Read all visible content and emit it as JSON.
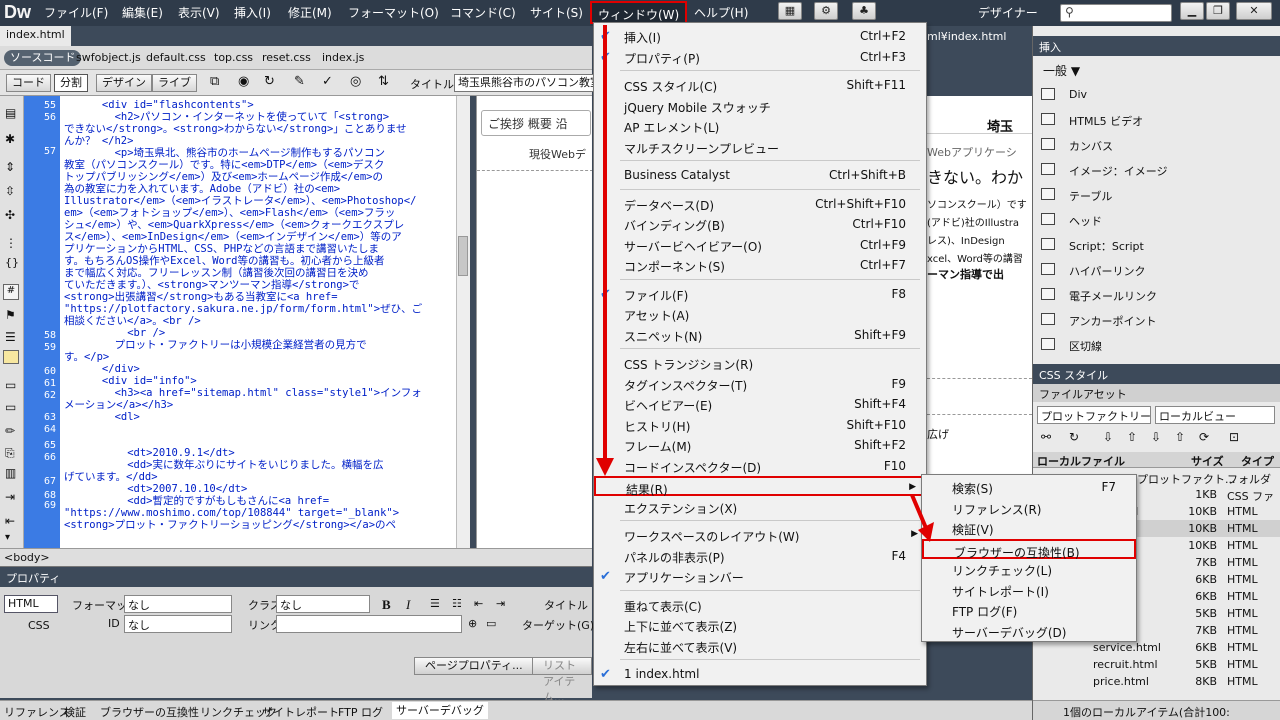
{
  "app": {
    "logo": "Dw",
    "workspace": "デザイナー"
  },
  "menubar": [
    "ファイル(F)",
    "編集(E)",
    "表示(V)",
    "挿入(I)",
    "修正(M)",
    "フォーマット(O)",
    "コマンド(C)",
    "サイト(S)",
    "ウィンドウ(W)",
    "ヘルプ(H)"
  ],
  "document": {
    "tab": "index.html",
    "path": "ml¥index.html",
    "related_files": [
      "ソースコード",
      "swfobject.js",
      "default.css",
      "top.css",
      "reset.css",
      "index.js"
    ],
    "view_buttons": [
      "コード",
      "分割",
      "デザイン",
      "ライブ"
    ],
    "title_label": "タイトル：",
    "title_value": "埼玉県熊谷市のパソコン教室"
  },
  "code": {
    "lines": [
      "55",
      "56",
      "57",
      "58",
      "59",
      "60",
      "61",
      "62",
      "63",
      "64",
      "65",
      "66",
      "67",
      "68",
      "69"
    ],
    "text": [
      "      <div id=\"flashcontents\">",
      "        <h2>パソコン・インターネットを使っていて「<strong>",
      "できない</strong>。<strong>わからない</strong>」ことありませ",
      "んか？ </h2>",
      "        <p>埼玉県北、熊谷市のホームページ制作もするパソコン",
      "教室（パソコンスクール）です。特に<em>DTP</em>（<em>デスク",
      "トップパブリッシング</em>）及び<em>ホームページ作成</em>の",
      "為の教室に力を入れています。Adobe（アドビ）社の<em>",
      "Illustrator</em>（<em>イラストレータ</em>）、<em>Photoshop</",
      "em>（<em>フォトショップ</em>）、<em>Flash</em>（<em>フラッ",
      "シュ</em>）や、<em>QuarkXpress</em>（<em>クォークエクスプレ",
      "ス</em>）、<em>InDesign</em>（<em>インデザイン</em>）等のア",
      "プリケーションからHTML、CSS、PHPなどの言語まで講習いたしま",
      "す。もちろんOS操作やExcel、Word等の講習も。初心者から上級者",
      "まで幅広く対応。フリーレッスン制（講習後次回の講習日を決め",
      "ていただきます。）、<strong>マンツーマン指導</strong>で",
      "<strong>出張講習</strong>もある当教室に<a href=",
      "\"https://plotfactory.sakura.ne.jp/form/form.html\">ぜひ、ご",
      "相談ください</a>。<br />",
      "          <br />",
      "        プロット・ファクトリーは小規模企業経営者の見方で",
      "す。</p>",
      "      </div>",
      "      <div id=\"info\">",
      "        <h3><a href=\"sitemap.html\" class=\"style1\">インフォ",
      "メーション</a></h3>",
      "        <dl>",
      "",
      "",
      "          <dt>2010.9.1</dt>",
      "          <dd>実に数年ぶりにサイトをいじりました。横幅を広",
      "げています。</dd>",
      "          <dt>2007.10.10</dt>",
      "          <dd>暫定的ですがもしもさんに<a href=",
      "\"https://www.moshimo.com/top/108844\" target=\"_blank\">",
      "<strong>プロット・ファクトリーショッピング</strong></a>のペ"
    ]
  },
  "design": {
    "nav": "ご挨拶  概要  沿",
    "sub": "現役Webデ",
    "head": "埼玉",
    "frag": [
      "きない。わか",
      "ソコンスクール）です",
      "(アドビ)社のIllustra",
      "レス)、InDesign",
      "xcel、Word等の講習",
      "ーマン指導で出",
      "広げ"
    ],
    "wa": "Webアプリケーシ"
  },
  "status": "<body>",
  "properties": {
    "header": "プロパティ",
    "html": "HTML",
    "css": "CSS",
    "format_label": "フォーマット",
    "format_value": "なし",
    "class_label": "クラス",
    "class_value": "なし",
    "id_label": "ID",
    "id_value": "なし",
    "link_label": "リンク",
    "target_label": "ターゲット(G)",
    "title_label": "タイトル",
    "bold": "B",
    "italic": "I",
    "page_props": "ページプロパティ...",
    "list_item": "リストアイテム..."
  },
  "bottom_tabs": [
    "リファレンス",
    "検証",
    "ブラウザーの互換性",
    "リンクチェック",
    "サイトレポート",
    "FTP ログ",
    "サーバーデバッグ"
  ],
  "right_panel": {
    "insert_tab": "挿入",
    "category": "一般",
    "items": [
      "Div",
      "HTML5 ビデオ",
      "カンバス",
      "イメージ：イメージ",
      "テーブル",
      "ヘッド",
      "Script：Script",
      "ハイパーリンク",
      "電子メールリンク",
      "アンカーポイント",
      "区切線"
    ],
    "css_tab": "CSS スタイル",
    "files_tab": "ファイル",
    "assets_tab": "アセット",
    "site": "プロットファクトリー",
    "view": "ローカルビュー",
    "cols": [
      "ローカルファイル",
      "サイズ",
      "タイプ"
    ],
    "rows": [
      [
        "サイト - プロットファクト...",
        "",
        "フォルダ"
      ],
      [
        "",
        "1KB",
        "CSS ファ"
      ],
      [
        "set.html",
        "10KB",
        "HTML"
      ],
      [
        "ml",
        "10KB",
        "HTML"
      ],
      [
        "html",
        "10KB",
        "HTML"
      ],
      [
        "html",
        "7KB",
        "HTML"
      ],
      [
        "html",
        "6KB",
        "HTML"
      ],
      [
        "html",
        "6KB",
        "HTML"
      ],
      [
        "ks.html",
        "5KB",
        "HTML"
      ],
      [
        "html",
        "7KB",
        "HTML"
      ],
      [
        "service.html",
        "6KB",
        "HTML"
      ],
      [
        "recruit.html",
        "5KB",
        "HTML"
      ],
      [
        "price.html",
        "8KB",
        "HTML"
      ]
    ],
    "footer": "1個のローカルアイテム(合計100:"
  },
  "window_menu": {
    "items": [
      {
        "label": "挿入(I)",
        "shortcut": "Ctrl+F2",
        "checked": true
      },
      {
        "label": "プロパティ(P)",
        "shortcut": "Ctrl+F3",
        "checked": true
      },
      {
        "sep": true
      },
      {
        "label": "CSS スタイル(C)",
        "shortcut": "Shift+F11"
      },
      {
        "label": "jQuery Mobile スウォッチ",
        "shortcut": ""
      },
      {
        "label": "AP エレメント(L)",
        "shortcut": ""
      },
      {
        "label": "マルチスクリーンプレビュー",
        "shortcut": ""
      },
      {
        "sep": true
      },
      {
        "label": "Business Catalyst",
        "shortcut": "Ctrl+Shift+B"
      },
      {
        "sep": true
      },
      {
        "label": "データベース(D)",
        "shortcut": "Ctrl+Shift+F10"
      },
      {
        "label": "バインディング(B)",
        "shortcut": "Ctrl+F10"
      },
      {
        "label": "サーバービヘイビアー(O)",
        "shortcut": "Ctrl+F9"
      },
      {
        "label": "コンポーネント(S)",
        "shortcut": "Ctrl+F7"
      },
      {
        "sep": true
      },
      {
        "label": "ファイル(F)",
        "shortcut": "F8",
        "checked": true
      },
      {
        "label": "アセット(A)",
        "shortcut": ""
      },
      {
        "label": "スニペット(N)",
        "shortcut": "Shift+F9"
      },
      {
        "sep": true
      },
      {
        "label": "CSS トランジション(R)",
        "shortcut": ""
      },
      {
        "label": "タグインスペクター(T)",
        "shortcut": "F9"
      },
      {
        "label": "ビヘイビアー(E)",
        "shortcut": "Shift+F4"
      },
      {
        "label": "ヒストリ(H)",
        "shortcut": "Shift+F10"
      },
      {
        "label": "フレーム(M)",
        "shortcut": "Shift+F2"
      },
      {
        "label": "コードインスペクター(D)",
        "shortcut": "F10"
      },
      {
        "label": "結果(R)",
        "shortcut": "",
        "submenu": true,
        "highlight": true
      },
      {
        "label": "エクステンション(X)",
        "shortcut": ""
      },
      {
        "sep": true
      },
      {
        "label": "ワークスペースのレイアウト(W)",
        "shortcut": "",
        "submenu": true
      },
      {
        "label": "パネルの非表示(P)",
        "shortcut": "F4"
      },
      {
        "label": "アプリケーションバー",
        "shortcut": "",
        "checked": true
      },
      {
        "sep": true
      },
      {
        "label": "重ねて表示(C)",
        "shortcut": ""
      },
      {
        "label": "上下に並べて表示(Z)",
        "shortcut": ""
      },
      {
        "label": "左右に並べて表示(V)",
        "shortcut": ""
      },
      {
        "sep": true
      },
      {
        "label": "1 index.html",
        "shortcut": "",
        "checked": true
      }
    ]
  },
  "results_submenu": {
    "items": [
      {
        "label": "検索(S)",
        "shortcut": "F7"
      },
      {
        "label": "リファレンス(R)",
        "shortcut": ""
      },
      {
        "label": "検証(V)",
        "shortcut": ""
      },
      {
        "label": "ブラウザーの互換性(B)",
        "shortcut": "",
        "highlight": true
      },
      {
        "label": "リンクチェック(L)",
        "shortcut": ""
      },
      {
        "label": "サイトレポート(I)",
        "shortcut": ""
      },
      {
        "label": "FTP ログ(F)",
        "shortcut": ""
      },
      {
        "label": "サーバーデバッグ(D)",
        "shortcut": ""
      }
    ]
  },
  "colors": {
    "annotation": "#e00000",
    "menubar": "#2f3b4a",
    "gutter": "#3b7be4"
  }
}
